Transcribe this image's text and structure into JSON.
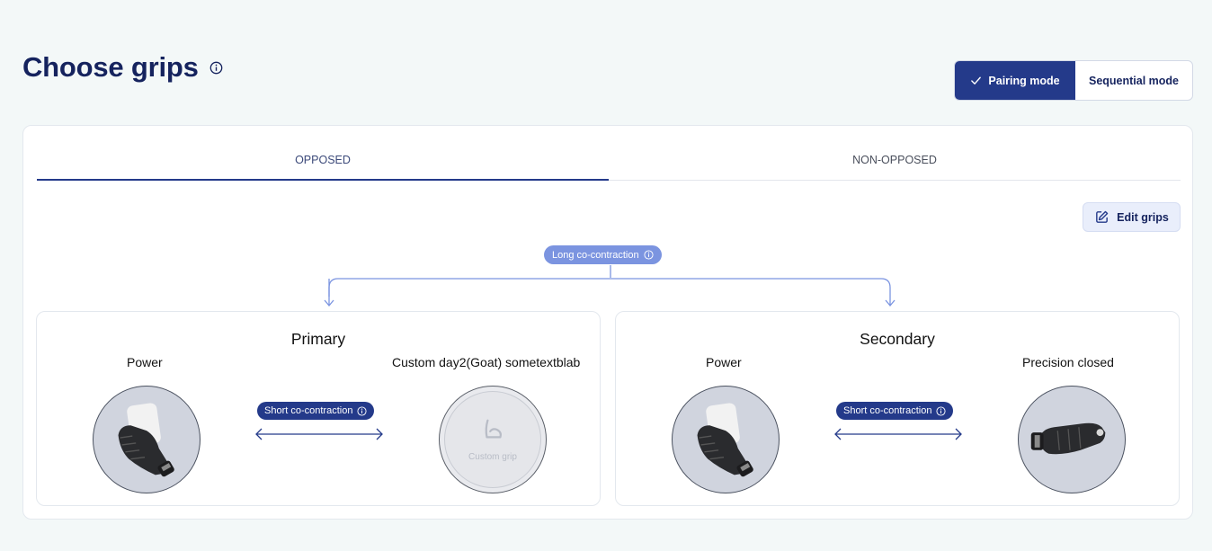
{
  "header": {
    "title": "Choose grips",
    "modes": {
      "pairing": "Pairing mode",
      "sequential": "Sequential mode"
    },
    "active_mode": "pairing"
  },
  "tabs": [
    {
      "label": "OPPOSED",
      "active": true
    },
    {
      "label": "NON-OPPOSED",
      "active": false
    }
  ],
  "edit_button": {
    "label": "Edit grips"
  },
  "long_cocontraction": {
    "label": "Long co-contraction"
  },
  "groups": {
    "primary": {
      "title": "Primary",
      "left_grip": {
        "label": "Power",
        "image": "power-grip-hand"
      },
      "right_grip": {
        "label": "Custom day2(Goat) sometextblab",
        "placeholder_text": "Custom grip",
        "image": "custom-grip-icon"
      },
      "short_label": "Short co-contraction"
    },
    "secondary": {
      "title": "Secondary",
      "left_grip": {
        "label": "Power",
        "image": "power-grip-hand"
      },
      "right_grip": {
        "label": "Precision closed",
        "image": "precision-closed-hand"
      },
      "short_label": "Short co-contraction"
    }
  },
  "colors": {
    "primary_navy": "#243a8a",
    "title_navy": "#15235e",
    "badge_light": "#7b94e0",
    "connector": "#7b94e0",
    "page_bg": "#f3f8f8"
  }
}
